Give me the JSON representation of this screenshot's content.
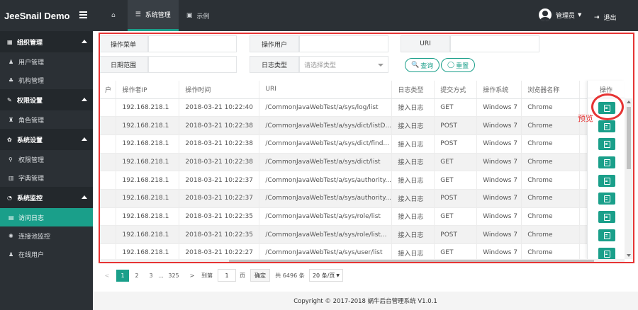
{
  "app": {
    "title": "JeeSnail Demo"
  },
  "colors": {
    "accent": "#1a9f8a",
    "topbar": "#2b3035",
    "highlight": "#e63434"
  },
  "topnav": {
    "items": [
      {
        "label": "",
        "icon": "home-icon"
      },
      {
        "label": "系统管理",
        "icon": "list-icon"
      },
      {
        "label": "示例",
        "icon": "image-icon"
      }
    ]
  },
  "user": {
    "name": "管理员",
    "logout": "退出"
  },
  "sidebar": {
    "groups": [
      {
        "label": "组织管理",
        "items": [
          "用户管理",
          "机构管理"
        ]
      },
      {
        "label": "权限设置",
        "items": [
          "角色管理"
        ]
      },
      {
        "label": "系统设置",
        "items": [
          "权限管理",
          "字典管理"
        ]
      },
      {
        "label": "系统监控",
        "items": [
          "访问日志",
          "连接池监控",
          "在线用户"
        ]
      }
    ]
  },
  "filters": {
    "menu_label": "操作菜单",
    "user_label": "操作用户",
    "uri_label": "URI",
    "date_label": "日期范围",
    "type_label": "日志类型",
    "type_placeholder": "请选择类型",
    "search_btn": "查询",
    "reset_btn": "重置"
  },
  "table": {
    "headers": [
      "户",
      "操作者IP",
      "操作时间",
      "URI",
      "日志类型",
      "提交方式",
      "操作系统",
      "浏览器名称",
      "操作"
    ],
    "rows": [
      [
        "",
        "192.168.218.1",
        "2018-03-21 10:22:40",
        "/CommonJavaWebTest/a/sys/log/list",
        "接入日志",
        "GET",
        "Windows 7",
        "Chrome"
      ],
      [
        "",
        "192.168.218.1",
        "2018-03-21 10:22:38",
        "/CommonJavaWebTest/a/sys/dict/listD...",
        "接入日志",
        "POST",
        "Windows 7",
        "Chrome"
      ],
      [
        "",
        "192.168.218.1",
        "2018-03-21 10:22:38",
        "/CommonJavaWebTest/a/sys/dict/find...",
        "接入日志",
        "POST",
        "Windows 7",
        "Chrome"
      ],
      [
        "",
        "192.168.218.1",
        "2018-03-21 10:22:38",
        "/CommonJavaWebTest/a/sys/dict/list",
        "接入日志",
        "GET",
        "Windows 7",
        "Chrome"
      ],
      [
        "",
        "192.168.218.1",
        "2018-03-21 10:22:37",
        "/CommonJavaWebTest/a/sys/authority...",
        "接入日志",
        "GET",
        "Windows 7",
        "Chrome"
      ],
      [
        "",
        "192.168.218.1",
        "2018-03-21 10:22:37",
        "/CommonJavaWebTest/a/sys/authority...",
        "接入日志",
        "POST",
        "Windows 7",
        "Chrome"
      ],
      [
        "",
        "192.168.218.1",
        "2018-03-21 10:22:35",
        "/CommonJavaWebTest/a/sys/role/list",
        "接入日志",
        "GET",
        "Windows 7",
        "Chrome"
      ],
      [
        "",
        "192.168.218.1",
        "2018-03-21 10:22:35",
        "/CommonJavaWebTest/a/sys/role/list...",
        "接入日志",
        "POST",
        "Windows 7",
        "Chrome"
      ],
      [
        "",
        "192.168.218.1",
        "2018-03-21 10:22:27",
        "/CommonJavaWebTest/a/sys/user/list",
        "接入日志",
        "GET",
        "Windows 7",
        "Chrome"
      ]
    ]
  },
  "annotation": {
    "text": "预览"
  },
  "pagination": {
    "prev": "<",
    "pages": [
      "1",
      "2",
      "3",
      "...",
      "325"
    ],
    "next": ">",
    "goto_label": "到第",
    "goto_value": "1",
    "page_unit": "页",
    "confirm": "确定",
    "total": "共 6496 条",
    "page_size": "20 条/页"
  },
  "footer": {
    "text": "Copyright © 2017-2018 蜗牛后台管理系统 V1.0.1"
  }
}
